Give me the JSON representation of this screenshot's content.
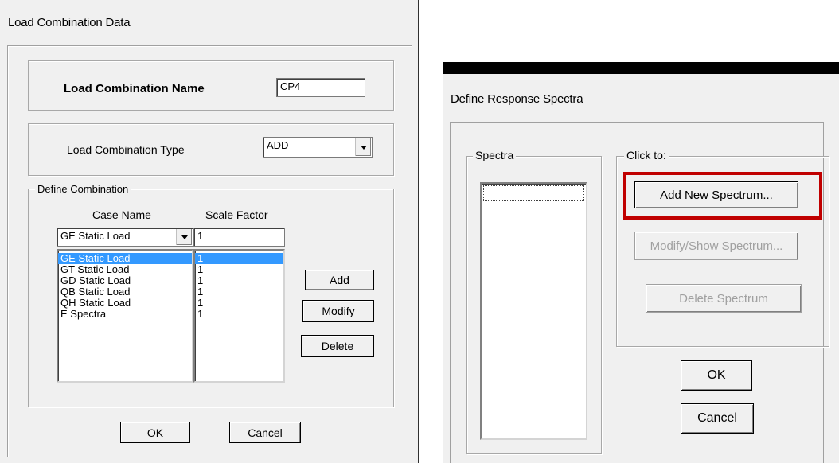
{
  "left": {
    "title": "Load Combination Data",
    "name_label": "Load Combination Name",
    "name_value": "CP4",
    "type_label": "Load Combination Type",
    "type_value": "ADD",
    "define_group": "Define Combination",
    "col_case": "Case Name",
    "col_scale": "Scale Factor",
    "case_select": "GE Static Load",
    "scale_input": "1",
    "cases": [
      "GE Static Load",
      "GT Static Load",
      "GD Static Load",
      "QB Static Load",
      "QH Static Load",
      "E Spectra"
    ],
    "scales": [
      "1",
      "1",
      "1",
      "1",
      "1",
      "1"
    ],
    "add": "Add",
    "modify": "Modify",
    "delete": "Delete",
    "ok": "OK",
    "cancel": "Cancel"
  },
  "right": {
    "title": "Define Response Spectra",
    "spectra_group": "Spectra",
    "click_group": "Click to:",
    "add_new": "Add New Spectrum...",
    "modify_show": "Modify/Show Spectrum...",
    "delete_spectrum": "Delete Spectrum",
    "ok": "OK",
    "cancel": "Cancel"
  },
  "colors": {
    "highlight": "#c00000",
    "selection": "#3399ff",
    "dialog_bg": "#f0f0f0"
  }
}
